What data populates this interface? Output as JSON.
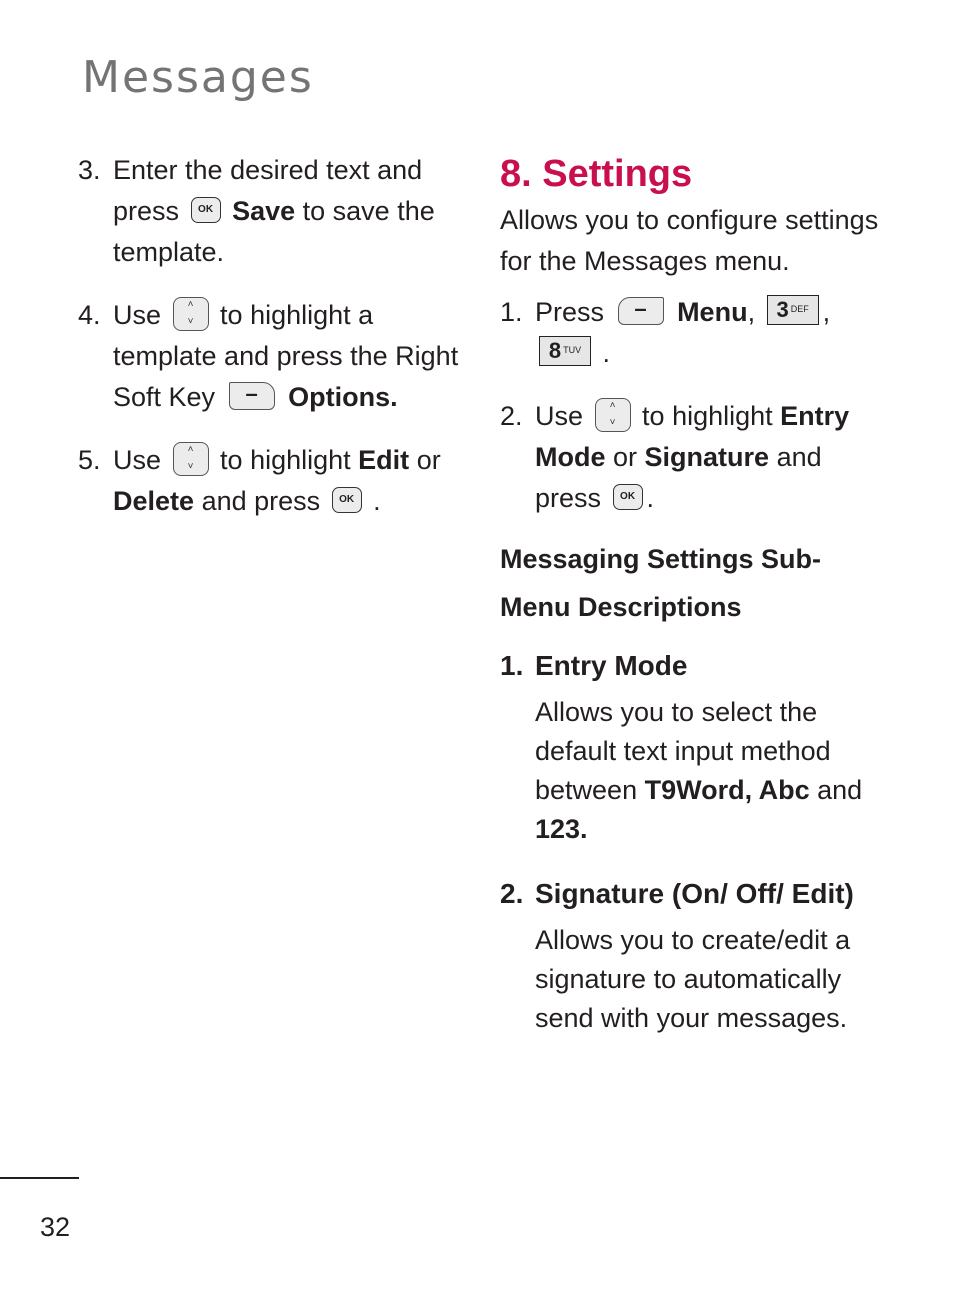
{
  "header": {
    "title": "Messages"
  },
  "left_column": {
    "steps": [
      {
        "num": "3.",
        "pre": "Enter the desired text and press",
        "key": "OK",
        "bold": "Save",
        "post": "to save the template."
      },
      {
        "num": "4.",
        "pre": "Use",
        "key": "navigation-up-down",
        "mid": "to highlight a template and press the Right Soft Key",
        "bold": "Options."
      },
      {
        "num": "5.",
        "pre": "Use",
        "key": "navigation-up-down",
        "mid": "to highlight",
        "bold1": "Edit",
        "or": "or",
        "bold2": "Delete",
        "post": "and press",
        "end": "."
      }
    ]
  },
  "right_column": {
    "section_title": "8. Settings",
    "intro": "Allows you to configure settings for the Messages menu.",
    "steps": [
      {
        "num": "1.",
        "pre": "Press",
        "bold": "Menu",
        "comma": ",",
        "key1_digit": "3",
        "key1_letters": "DEF",
        "key2_digit": "8",
        "key2_letters": "TUV",
        "end": "."
      },
      {
        "num": "2.",
        "pre": "Use",
        "mid": "to highlight",
        "bold1": "Entry Mode",
        "or": "or",
        "bold2": "Signature",
        "post": "and press",
        "end": "."
      }
    ],
    "subheading": "Messaging Settings Sub-Menu Descriptions",
    "items": [
      {
        "num": "1.",
        "title": "Entry Mode",
        "desc_pre": "Allows you to select the default text input method between",
        "desc_bold": "T9Word, Abc",
        "desc_and": "and",
        "desc_bold2": "123."
      },
      {
        "num": "2.",
        "title": "Signature (On/ Off/ Edit)",
        "desc": "Allows you to create/edit a signature to automatically send with your messages."
      }
    ]
  },
  "keys": {
    "ok_label": "OK",
    "nav_up": "˄",
    "nav_down": "˅",
    "soft_dash": "–"
  },
  "footer": {
    "page_number": "32"
  },
  "colors": {
    "accent": "#c8104f",
    "title_gray": "#747474",
    "text": "#231f20"
  }
}
